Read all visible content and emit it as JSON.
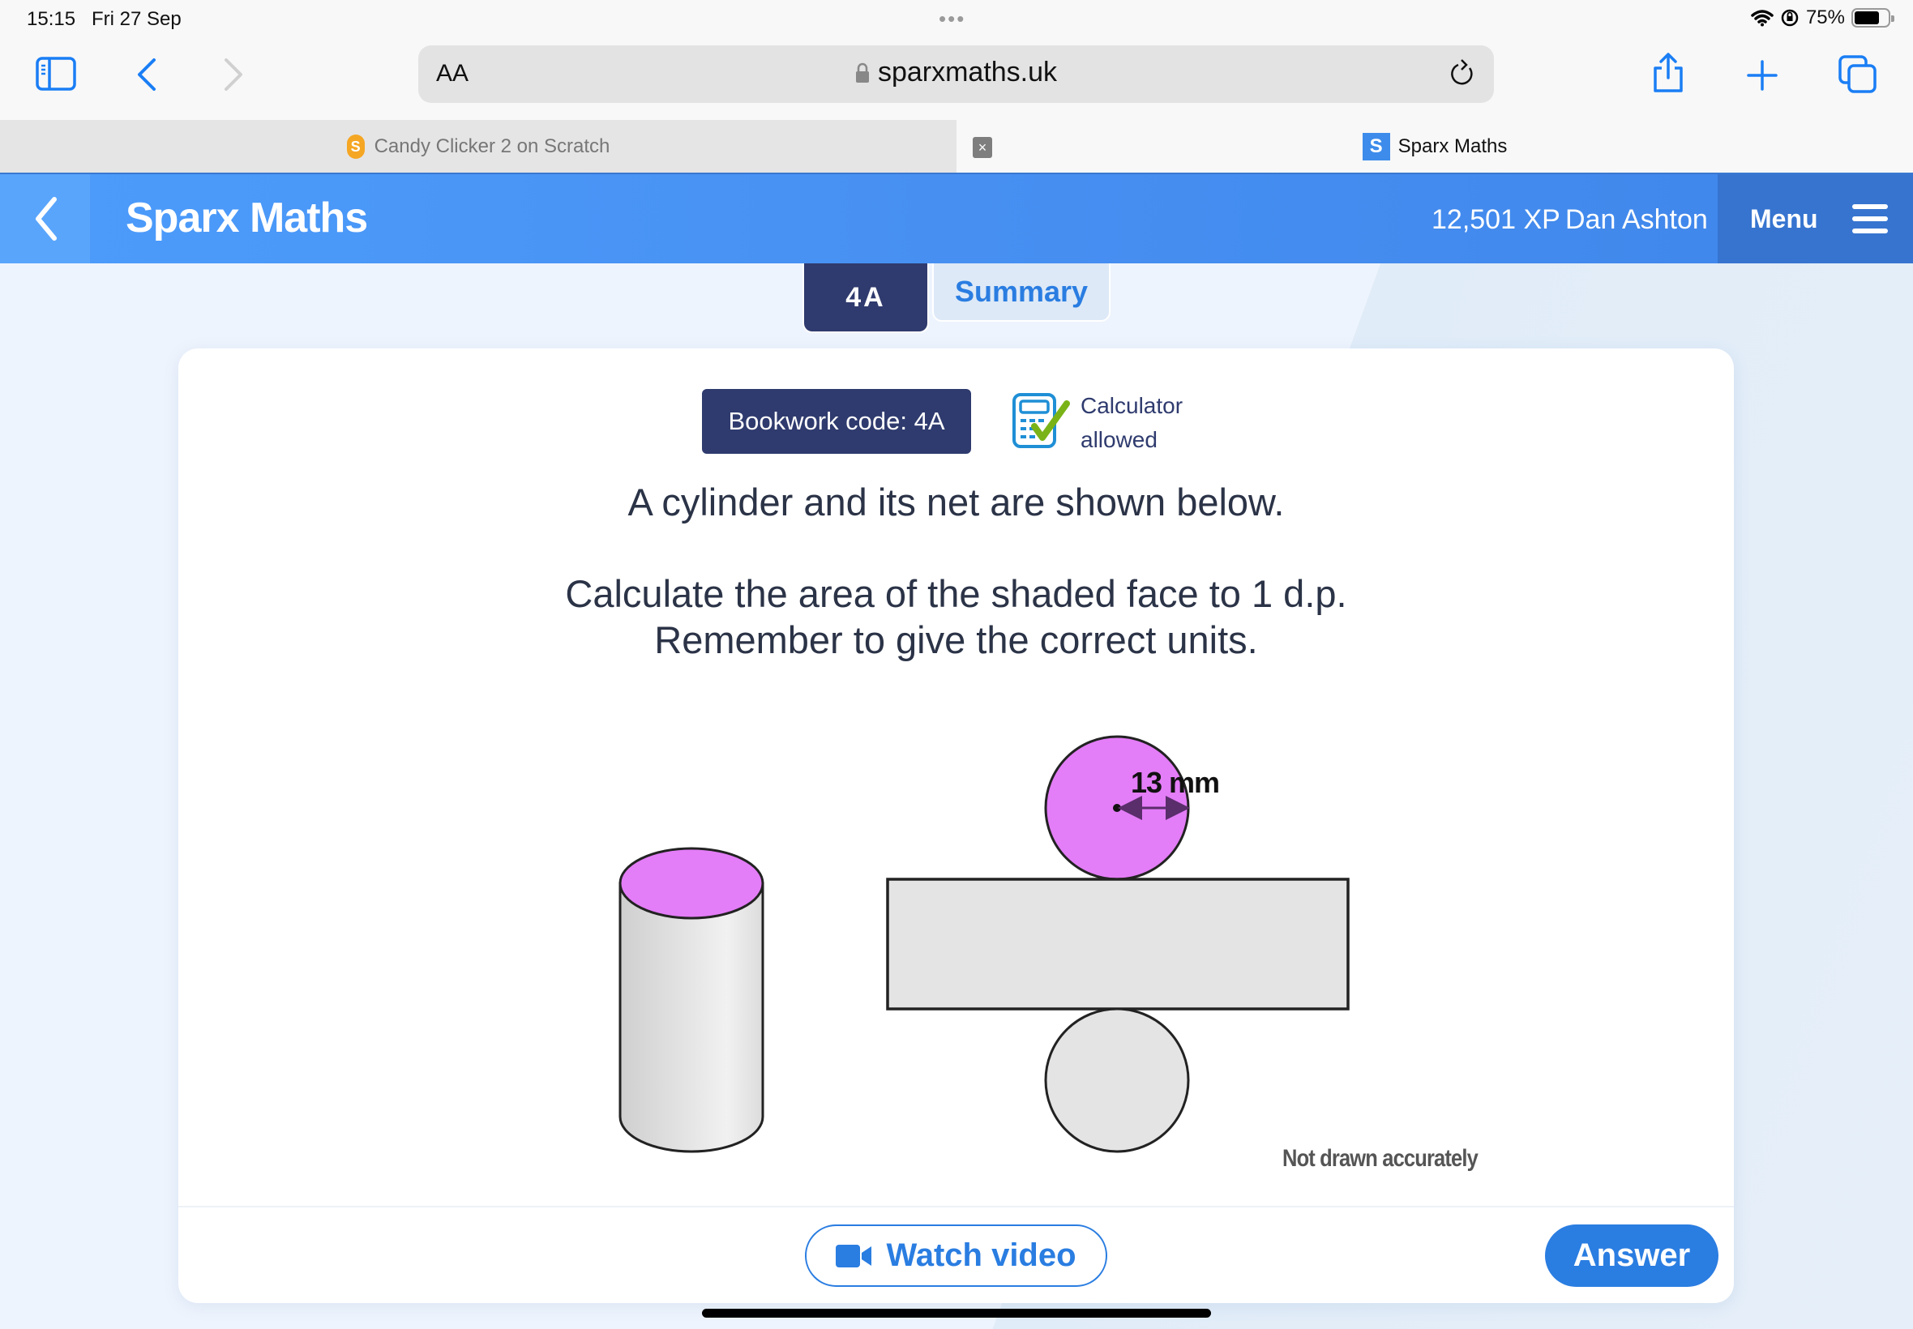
{
  "status_bar": {
    "time": "15:15",
    "date": "Fri 27 Sep",
    "battery_percent": "75%",
    "battery_level": 0.75
  },
  "browser": {
    "url_text_size_label": "AA",
    "url": "sparxmaths.uk",
    "tabs": [
      {
        "title": "Candy Clicker 2 on Scratch",
        "favicon": "S",
        "active": false
      },
      {
        "title": "Sparx Maths",
        "favicon": "S",
        "active": true
      }
    ],
    "close_tab_glyph": "×"
  },
  "app_header": {
    "title": "Sparx Maths",
    "xp": "12,501 XP",
    "user_name": "Dan Ashton",
    "menu_label": "Menu"
  },
  "task_tabs": [
    {
      "label": "4A",
      "active": true
    },
    {
      "label": "Summary",
      "active": false
    }
  ],
  "question": {
    "bookwork_code": "Bookwork code: 4A",
    "calculator_line1": "Calculator",
    "calculator_line2": "allowed",
    "line1": "A cylinder and its net are shown below.",
    "line2": "Calculate the area of the shaded face to 1 d.p.",
    "line3": "Remember to give the correct units.",
    "diagram": {
      "radius_label": "13 mm",
      "note": "Not drawn accurately",
      "shaded_color": "#e47df8",
      "unshaded_color": "#e4e4e4"
    }
  },
  "actions": {
    "watch_video": "Watch video",
    "answer": "Answer"
  },
  "colors": {
    "brand_blue": "#4790f2",
    "navy": "#2f3b6e",
    "accent_blue": "#2a7de1",
    "check_green": "#7ab317"
  }
}
